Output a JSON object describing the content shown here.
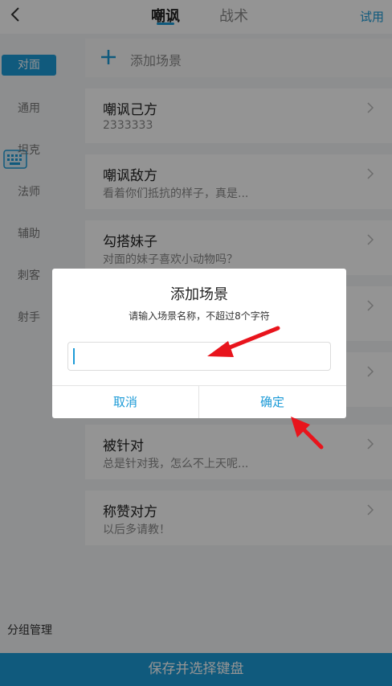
{
  "topbar": {
    "tabs": [
      {
        "label": "嘲讽"
      },
      {
        "label": "战术"
      }
    ],
    "trial_label": "试用"
  },
  "sidebar": {
    "items": [
      {
        "label": "对面"
      },
      {
        "label": "通用"
      },
      {
        "label": "坦克"
      },
      {
        "label": "法师"
      },
      {
        "label": "辅助"
      },
      {
        "label": "刺客"
      },
      {
        "label": "射手"
      }
    ],
    "group_manage_label": "分组管理"
  },
  "content": {
    "add_label": "添加场景",
    "cards": [
      {
        "title": "嘲讽己方",
        "subtitle": "2333333"
      },
      {
        "title": "嘲讽敌方",
        "subtitle": "看着你们抵抗的样子，真是..."
      },
      {
        "title": "勾搭妹子",
        "subtitle": "对面的妹子喜欢小动物吗？"
      },
      {
        "title": "",
        "subtitle": ""
      },
      {
        "title": "",
        "subtitle": ""
      },
      {
        "title": "被针对",
        "subtitle": "总是针对我，怎么不上天呢..."
      },
      {
        "title": "称赞对方",
        "subtitle": "以后多请教！"
      }
    ]
  },
  "bottombar": {
    "label": "保存并选择键盘"
  },
  "dialog": {
    "title": "添加场景",
    "message": "请输入场景名称，不超过8个字符",
    "input_value": "",
    "cancel_label": "取消",
    "ok_label": "确定"
  },
  "colors": {
    "accent": "#1d9bd7",
    "annotation": "#e8141c"
  }
}
